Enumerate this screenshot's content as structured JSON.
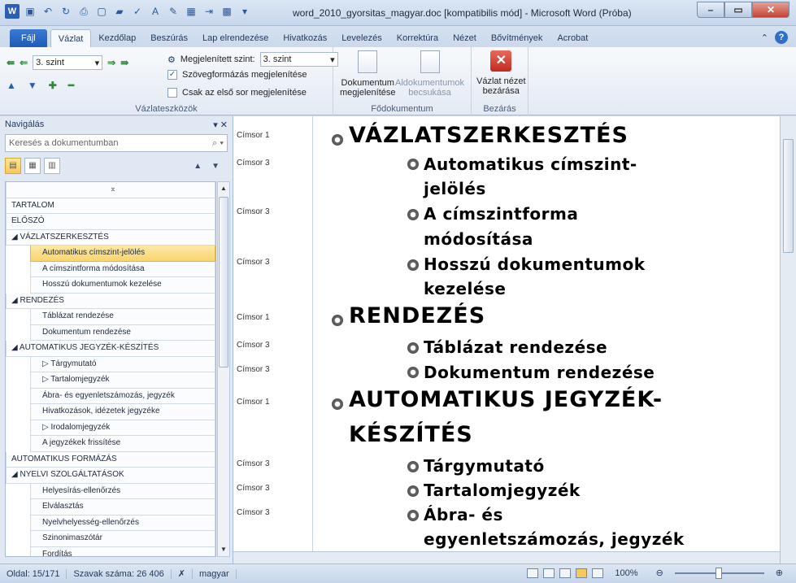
{
  "window": {
    "title": "word_2010_gyorsitas_magyar.doc [kompatibilis mód] - Microsoft Word (Próba)",
    "app_icon": "W"
  },
  "tabs": [
    "Fájl",
    "Vázlat",
    "Kezdőlap",
    "Beszúrás",
    "Lap elrendezése",
    "Hivatkozás",
    "Levelezés",
    "Korrektúra",
    "Nézet",
    "Bővítmények",
    "Acrobat"
  ],
  "active_tab": "Vázlat",
  "ribbon": {
    "level_select": "3. szint",
    "show_level_label": "Megjelenített szint:",
    "show_level_value": "3. szint",
    "text_format_label": "Szövegformázás megjelenítése",
    "first_line_label": "Csak az első sor megjelenítése",
    "group1_label": "Vázlateszközök",
    "show_doc_label_1": "Dokumentum",
    "show_doc_label_2": "megjelenítése",
    "collapse_sub_label_1": "Aldokumentumok",
    "collapse_sub_label_2": "becsukása",
    "group2_label": "Fődokumentum",
    "close_outline_label_1": "Vázlat nézet",
    "close_outline_label_2": "bezárása",
    "group3_label": "Bezárás"
  },
  "nav": {
    "title": "Navigálás",
    "search_placeholder": "Keresés a dokumentumban",
    "items": [
      {
        "label": "⌅",
        "level": 0
      },
      {
        "label": "TARTALOM",
        "level": 1
      },
      {
        "label": "ELŐSZÓ",
        "level": 1
      },
      {
        "label": "◢ VÁZLATSZERKESZTÉS",
        "level": 1
      },
      {
        "label": "Automatikus címszint-jelölés",
        "level": 2,
        "selected": true
      },
      {
        "label": "A címszintforma módosítása",
        "level": 2
      },
      {
        "label": "Hosszú dokumentumok kezelése",
        "level": 2
      },
      {
        "label": "◢ RENDEZÉS",
        "level": 1
      },
      {
        "label": "Táblázat rendezése",
        "level": 2
      },
      {
        "label": "Dokumentum rendezése",
        "level": 2
      },
      {
        "label": "◢ AUTOMATIKUS JEGYZÉK-KÉSZÍTÉS",
        "level": 1
      },
      {
        "label": "▷ Tárgymutató",
        "level": 2
      },
      {
        "label": "▷ Tartalomjegyzék",
        "level": 2
      },
      {
        "label": "Ábra- és egyenletszámozás, jegyzék",
        "level": 2
      },
      {
        "label": "Hivatkozások, idézetek jegyzéke",
        "level": 2
      },
      {
        "label": "▷ Irodalomjegyzék",
        "level": 2
      },
      {
        "label": "A jegyzékek frissítése",
        "level": 2
      },
      {
        "label": "AUTOMATIKUS FORMÁZÁS",
        "level": 1
      },
      {
        "label": "◢ NYELVI SZOLGÁLTATÁSOK",
        "level": 1
      },
      {
        "label": "Helyesírás-ellenőrzés",
        "level": 2
      },
      {
        "label": "Elválasztás",
        "level": 2
      },
      {
        "label": "Nyelvhelyesség-ellenőrzés",
        "level": 2
      },
      {
        "label": "Szinonimaszótár",
        "level": 2
      },
      {
        "label": "Fordítás",
        "level": 2
      }
    ]
  },
  "styles": [
    "Címsor 1",
    "Címsor 3",
    "Címsor 3",
    "Címsor 3",
    "Címsor 1",
    "Címsor 3",
    "Címsor 3",
    "Címsor 1",
    "Címsor 3",
    "Címsor 3",
    "Címsor 3"
  ],
  "doc": {
    "h_vazlat": "VÁZLATSZERKESZTÉS",
    "h_auto1": "Automatikus címszint-",
    "h_auto2": "jelölés",
    "h_cim1": "A címszintforma",
    "h_cim2": "módosítása",
    "h_hossz1": "Hosszú dokumentumok",
    "h_hossz2": "kezelése",
    "h_rend": "RENDEZÉS",
    "h_tabl": "Táblázat rendezése",
    "h_dok": "Dokumentum rendezése",
    "h_autom1": "AUTOMATIKUS JEGYZÉK-",
    "h_autom2": "KÉSZÍTÉS",
    "h_targy": "Tárgymutató",
    "h_tart": "Tartalomjegyzék",
    "h_abra1": "Ábra- és",
    "h_abra2": "egyenletszámozás, jegyzék"
  },
  "status": {
    "page": "Oldal: 15/171",
    "words": "Szavak száma: 26 406",
    "language": "magyar",
    "zoom": "100%"
  }
}
